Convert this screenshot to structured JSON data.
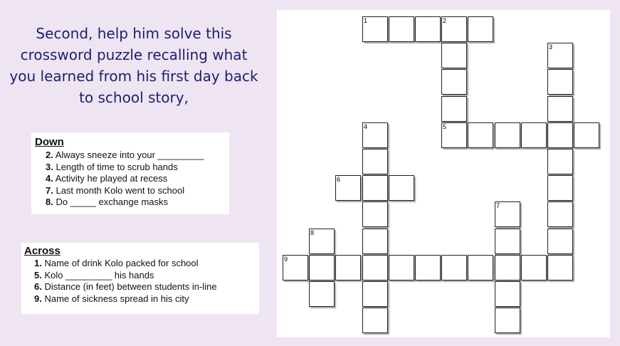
{
  "intro_text": "Second, help him solve this crossword puzzle recalling what you learned from his first day back to school story,",
  "down": {
    "title": "Down",
    "clues": [
      {
        "num": "2.",
        "text": "Always sneeze into your _________"
      },
      {
        "num": "3.",
        "text": "Length of time to scrub hands"
      },
      {
        "num": "4.",
        "text": "Activity he played at recess"
      },
      {
        "num": "7.",
        "text": "Last month Kolo went to school"
      },
      {
        "num": "8.",
        "text": "Do _____ exchange masks"
      }
    ]
  },
  "across": {
    "title": "Across",
    "clues": [
      {
        "num": "1.",
        "text": "Name of drink Kolo packed for school"
      },
      {
        "num": "5.",
        "text": "Kolo _________ his hands"
      },
      {
        "num": "6.",
        "text": "Distance (in feet) between students in-line"
      },
      {
        "num": "9.",
        "text": "Name of sickness spread in his city"
      }
    ]
  },
  "cell_numbers": [
    "1",
    "2",
    "3",
    "4",
    "5",
    "6",
    "7",
    "8",
    "9"
  ]
}
